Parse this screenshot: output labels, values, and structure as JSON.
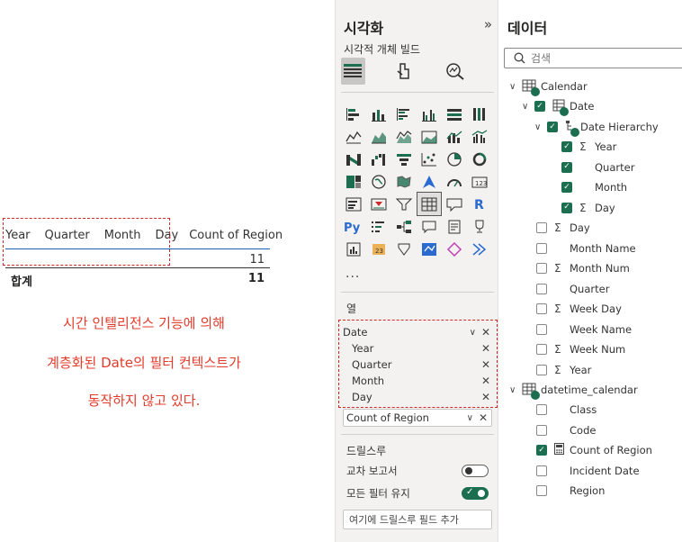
{
  "canvas": {
    "matrix": {
      "headers": [
        "Year",
        "Quarter",
        "Month",
        "Day",
        "Count of Region"
      ],
      "value": "11",
      "total_label": "합계",
      "total_value": "11"
    },
    "annotation": [
      "시간 인텔리전스 기능에 의해",
      "계층화된 Date의 필터 컨텍스트가",
      "동작하지 않고 있다."
    ]
  },
  "viz_pane": {
    "title": "시각화",
    "build_label": "시각적 개체 빌드",
    "more": "...",
    "columns_label": "열",
    "well": {
      "group": "Date",
      "items": [
        "Year",
        "Quarter",
        "Month",
        "Day"
      ],
      "values_field": "Count of Region"
    },
    "drillthrough_label": "드릴스루",
    "cross_report_label": "교차 보고서",
    "keep_filters_label": "모든 필터 유지",
    "cross_report_on": false,
    "keep_filters_on": true,
    "add_drill_placeholder": "여기에 드릴스루 필드 추가"
  },
  "data_pane": {
    "title": "데이터",
    "search_placeholder": "검색",
    "calendar": "Calendar",
    "date": "Date",
    "date_hierarchy": "Date Hierarchy",
    "hierarchy_levels": [
      {
        "label": "Year",
        "sigma": true,
        "checked": true
      },
      {
        "label": "Quarter",
        "sigma": false,
        "checked": true
      },
      {
        "label": "Month",
        "sigma": false,
        "checked": true
      },
      {
        "label": "Day",
        "sigma": true,
        "checked": true
      }
    ],
    "calendar_fields": [
      {
        "label": "Day",
        "sigma": true
      },
      {
        "label": "Month Name",
        "sigma": false
      },
      {
        "label": "Month Num",
        "sigma": true
      },
      {
        "label": "Quarter",
        "sigma": false
      },
      {
        "label": "Week Day",
        "sigma": true
      },
      {
        "label": "Week Name",
        "sigma": false
      },
      {
        "label": "Week Num",
        "sigma": true
      },
      {
        "label": "Year",
        "sigma": true
      }
    ],
    "datetime_calendar": "datetime_calendar",
    "dt_fields": [
      {
        "label": "Class",
        "type": "text",
        "checked": false
      },
      {
        "label": "Code",
        "type": "text",
        "checked": false
      },
      {
        "label": "Count of Region",
        "type": "calc",
        "checked": true
      },
      {
        "label": "Incident Date",
        "type": "text",
        "checked": false
      },
      {
        "label": "Region",
        "type": "text",
        "checked": false
      }
    ]
  }
}
